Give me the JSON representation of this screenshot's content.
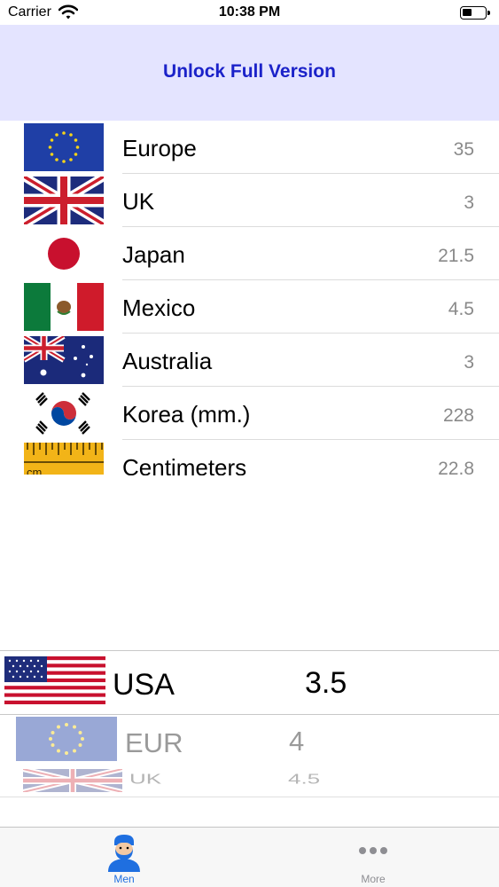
{
  "status_bar": {
    "carrier": "Carrier",
    "time": "10:38 PM",
    "battery_level_percent": 40
  },
  "banner": {
    "label": "Unlock Full Version",
    "background_color": "#e4e4ff",
    "text_color": "#1b22c9"
  },
  "size_list": [
    {
      "name": "Europe",
      "value": "35",
      "flag": "eu-flag-icon"
    },
    {
      "name": "UK",
      "value": "3",
      "flag": "uk-flag-icon"
    },
    {
      "name": "Japan",
      "value": "21.5",
      "flag": "japan-flag-icon"
    },
    {
      "name": "Mexico",
      "value": "4.5",
      "flag": "mexico-flag-icon"
    },
    {
      "name": "Australia",
      "value": "3",
      "flag": "australia-flag-icon"
    },
    {
      "name": "Korea (mm.)",
      "value": "228",
      "flag": "korea-flag-icon"
    },
    {
      "name": "Centimeters",
      "value": "22.8",
      "flag": "ruler-icon"
    }
  ],
  "picker": {
    "selected": {
      "code": "USA",
      "value": "3.5",
      "flag": "usa-flag-icon"
    },
    "next": [
      {
        "code": "EUR",
        "value": "4",
        "flag": "eu-flag-icon"
      },
      {
        "code": "UK",
        "value": "4.5",
        "flag": "uk-flag-icon"
      }
    ]
  },
  "tab_bar": {
    "tabs": [
      {
        "label": "Men",
        "icon": "man-avatar-icon",
        "active": true
      },
      {
        "label": "More",
        "icon": "more-dots-icon",
        "active": false
      }
    ],
    "active_color": "#1f6fe0",
    "inactive_color": "#8e8e93"
  }
}
